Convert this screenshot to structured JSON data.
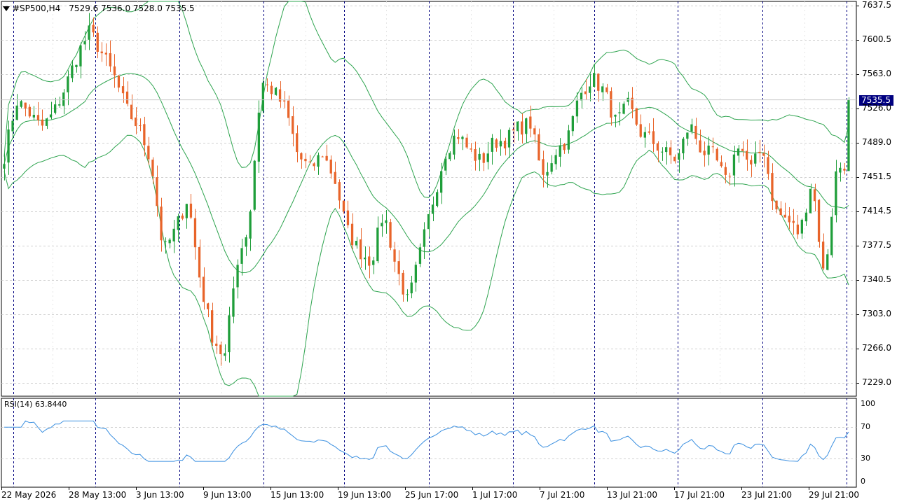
{
  "header": {
    "symbol": "#SP500,H4",
    "ohlc": "7529.6 7536.0 7528.0 7535.5"
  },
  "rsi_header": "RSI(14) 63.8440",
  "current_price": "7535.5",
  "price_axis": [
    "7637.5",
    "7600.5",
    "7563.0",
    "7526.0",
    "7489.0",
    "7451.5",
    "7414.5",
    "7377.5",
    "7340.5",
    "7303.0",
    "7266.0",
    "7229.0"
  ],
  "rsi_axis": [
    "100",
    "70",
    "30",
    "0"
  ],
  "time_axis": [
    "22 May 2026",
    "28 May 13:00",
    "3 Jun 13:00",
    "9 Jun 13:00",
    "15 Jun 13:00",
    "19 Jun 13:00",
    "25 Jun 17:00",
    "1 Jul 17:00",
    "7 Jul 21:00",
    "13 Jul 21:00",
    "17 Jul 21:00",
    "23 Jul 21:00",
    "29 Jul 21:00"
  ],
  "colors": {
    "bull": "#1f9e3a",
    "bear": "#e8642a",
    "bands": "#2ea44f",
    "rsi": "#3a8fe0",
    "separator": "#000080",
    "grid": "#d0d0d0"
  },
  "chart_data": {
    "type": "candlestick",
    "timeframe": "H4",
    "ylim": [
      7218,
      7642
    ],
    "bollinger": true,
    "rsi_period": 14,
    "rsi_last": 63.844,
    "rsi_levels": [
      30,
      70
    ],
    "closes_approx": [
      7475,
      7535,
      7522,
      7505,
      7520,
      7550,
      7585,
      7610,
      7585,
      7560,
      7525,
      7505,
      7470,
      7370,
      7395,
      7430,
      7340,
      7280,
      7255,
      7360,
      7400,
      7555,
      7545,
      7525,
      7475,
      7460,
      7478,
      7450,
      7395,
      7372,
      7360,
      7415,
      7355,
      7315,
      7370,
      7425,
      7478,
      7500,
      7480,
      7468,
      7490,
      7492,
      7505,
      7510,
      7450,
      7480,
      7492,
      7540,
      7560,
      7545,
      7510,
      7530,
      7500,
      7490,
      7478,
      7470,
      7510,
      7480,
      7475,
      7445,
      7490,
      7460,
      7485,
      7415,
      7405,
      7390,
      7450,
      7340,
      7460,
      7470
    ],
    "note_ohlc_last": [
      7529.6,
      7536.0,
      7528.0,
      7535.5
    ]
  }
}
